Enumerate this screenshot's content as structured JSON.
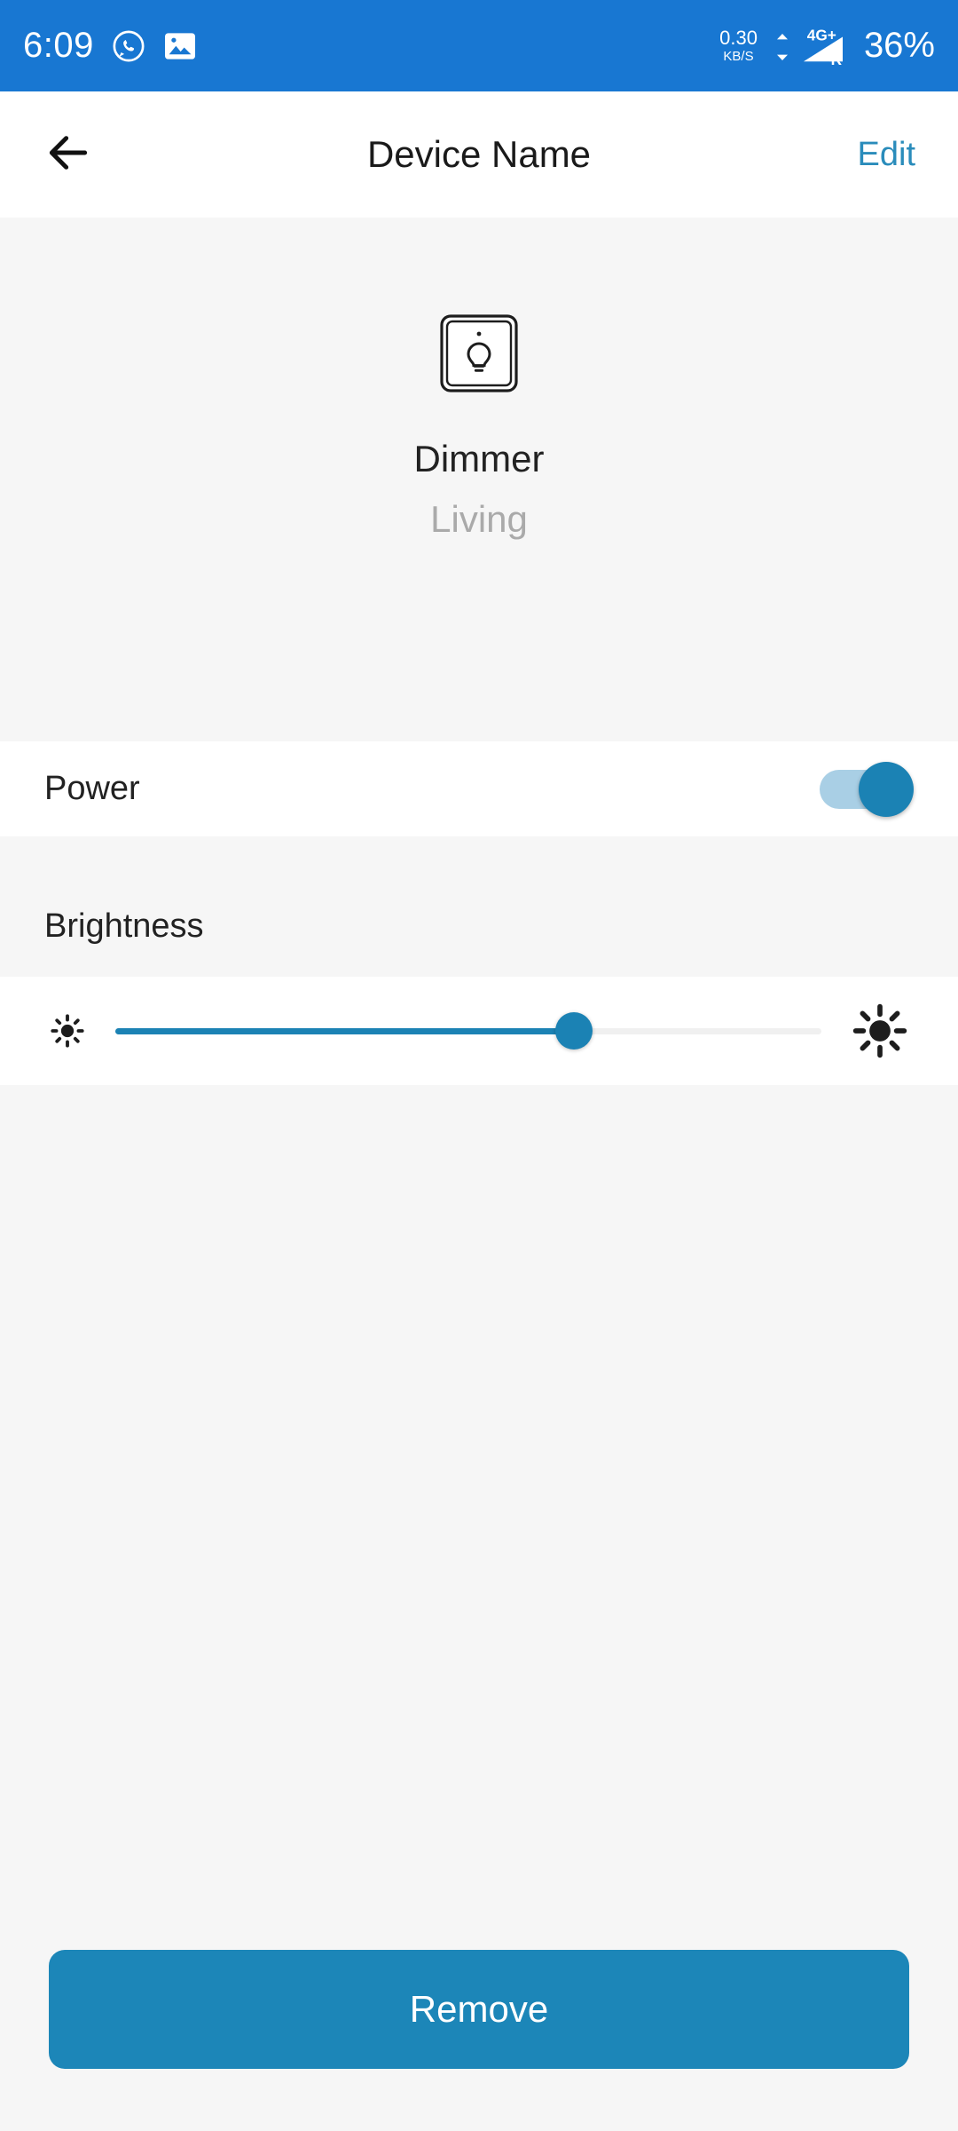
{
  "status_bar": {
    "time": "6:09",
    "icons": [
      "whatsapp-icon",
      "gallery-icon"
    ],
    "network_speed_value": "0.30",
    "network_speed_unit": "KB/S",
    "network_type": "4G+",
    "roaming_indicator": "R",
    "battery": "36%",
    "background_color": "#1877d2"
  },
  "app_bar": {
    "back_icon": "back-arrow-icon",
    "title": "Device Name",
    "edit_label": "Edit",
    "edit_color": "#2a8cbb"
  },
  "hero": {
    "device_icon": "dimmer-switch-bulb-icon",
    "device_name": "Dimmer",
    "room_name": "Living"
  },
  "power": {
    "label": "Power",
    "toggle_state": "on",
    "toggle_on_color": "#1b82b4",
    "toggle_track_color": "#a9cfe5"
  },
  "brightness": {
    "label": "Brightness",
    "value_percent": 65,
    "min_icon": "sun-low-icon",
    "max_icon": "sun-high-icon",
    "fill_color": "#1b82b4",
    "track_color": "#f0f0f0"
  },
  "actions": {
    "remove_label": "Remove",
    "remove_color": "#1c86b8"
  }
}
